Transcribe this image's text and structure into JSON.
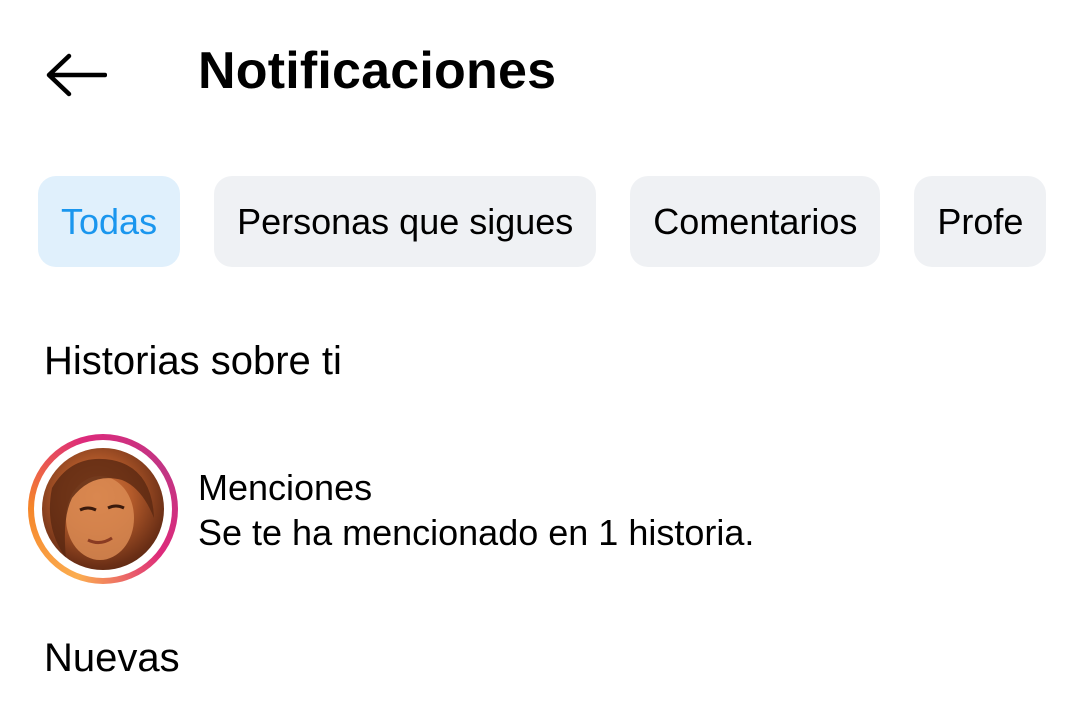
{
  "header": {
    "back_icon": "arrow-left-icon",
    "title": "Notificaciones"
  },
  "filters": {
    "chips": [
      {
        "label": "Todas",
        "active": true
      },
      {
        "label": "Personas que sigues",
        "active": false
      },
      {
        "label": "Comentarios",
        "active": false
      },
      {
        "label": "Profe",
        "active": false
      }
    ]
  },
  "stories_section": {
    "title": "Historias sobre ti",
    "mention": {
      "title": "Menciones",
      "text": "Se te ha mencionado en 1 historia."
    }
  },
  "new_section": {
    "title": "Nuevas"
  },
  "colors": {
    "active_chip_bg": "#e0f0fc",
    "active_chip_text": "#1a96ee",
    "chip_bg": "#eff1f4",
    "story_ring": [
      "#fbad50",
      "#dd2a7b",
      "#c13584"
    ]
  }
}
